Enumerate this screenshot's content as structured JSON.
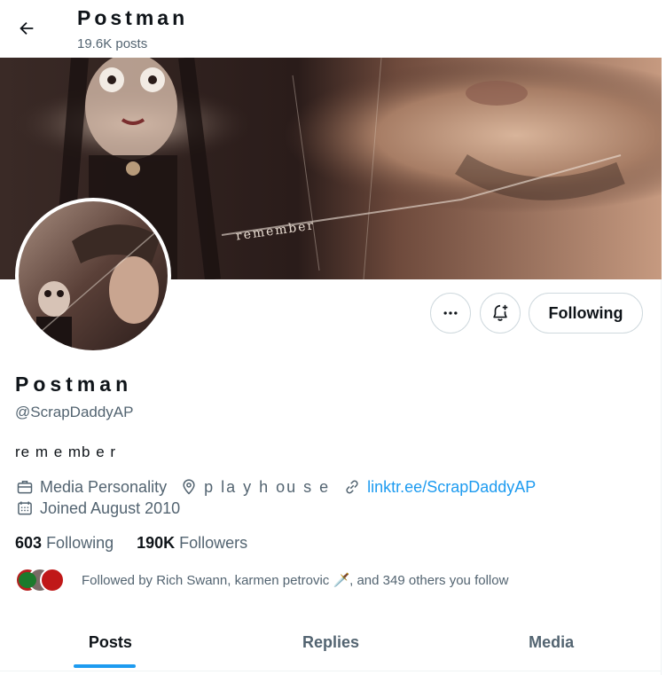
{
  "header": {
    "title": "Postman",
    "post_count": "19.6K posts"
  },
  "banner": {
    "overlay_text": "remember"
  },
  "actions": {
    "following_label": "Following"
  },
  "profile": {
    "name": "Postman",
    "handle": "@ScrapDaddyAP",
    "bio": "re m e mb e r",
    "category": "Media Personality",
    "location": "p la y h ou s e",
    "link": "linktr.ee/ScrapDaddyAP",
    "joined": "Joined August 2010"
  },
  "stats": {
    "following_count": "603",
    "following_label": "Following",
    "followers_count": "190K",
    "followers_label": "Followers"
  },
  "followed_by": {
    "text": "Followed by Rich Swann, karmen petrovic 🗡️, and 349 others you follow"
  },
  "tabs": [
    {
      "label": "Posts",
      "active": true
    },
    {
      "label": "Replies",
      "active": false
    },
    {
      "label": "Media",
      "active": false
    }
  ],
  "colors": {
    "accent": "#1d9bf0",
    "text_primary": "#0f1419",
    "text_secondary": "#536471",
    "border": "#cfd9de"
  },
  "icons": {
    "back": "arrow-left-icon",
    "more": "more-dots-icon",
    "notify": "bell-plus-icon",
    "category": "briefcase-icon",
    "location": "location-pin-icon",
    "link": "link-icon",
    "joined": "calendar-icon"
  }
}
